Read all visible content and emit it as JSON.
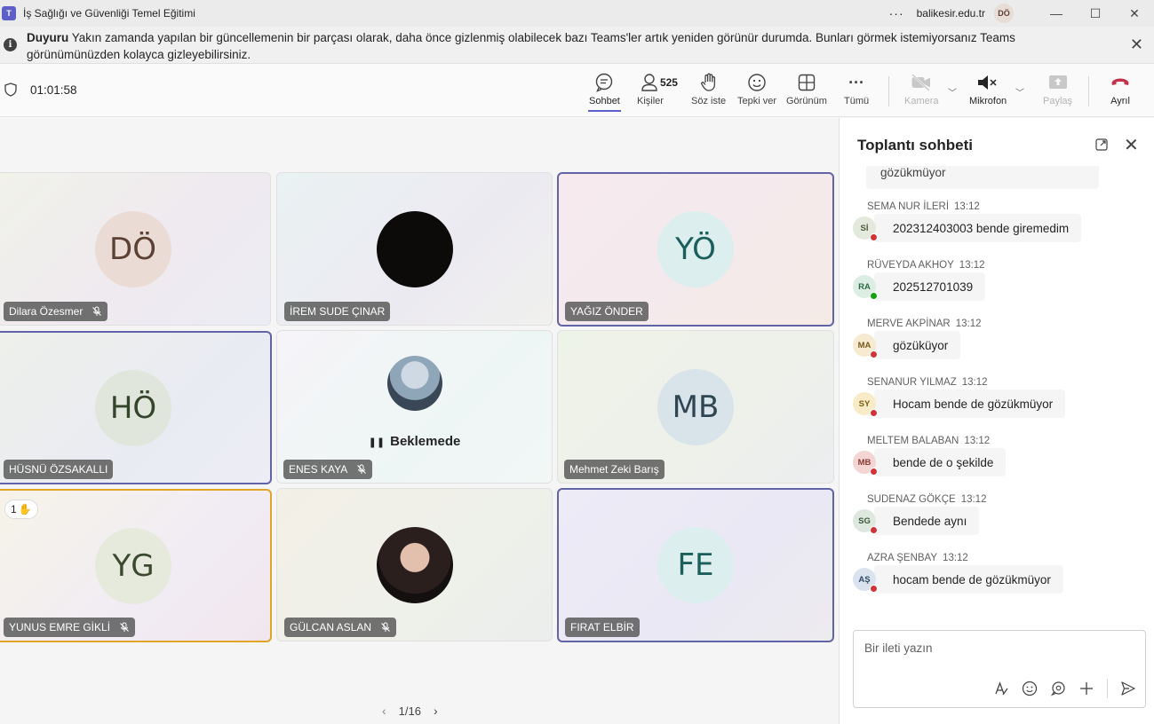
{
  "window": {
    "title": "İş Sağlığı ve Güvenliği Temel Eğitimi",
    "more": "···",
    "org": "balikesir.edu.tr",
    "user_initials": "DÖ",
    "minimize": "—",
    "maximize": "☐",
    "close": "✕"
  },
  "banner": {
    "bold": "Duyuru",
    "text": " Yakın zamanda yapılan bir güncellemenin bir parçası olarak, daha önce gizlenmiş olabilecek bazı Teams'ler artık yeniden görünür durumda. Bunları görmek istemiyorsanız Teams görünümünüzden kolayca gizleyebilirsiniz.",
    "close": "✕"
  },
  "toolbar": {
    "timer": "01:01:58",
    "chat": "Sohbet",
    "people": "Kişiler",
    "people_count": "525",
    "raise": "Söz iste",
    "react": "Tepki ver",
    "view": "Görünüm",
    "more": "Tümü",
    "more_glyph": "···",
    "camera": "Kamera",
    "mic": "Mikrofon",
    "share": "Paylaş",
    "leave": "Ayrıl"
  },
  "tiles": [
    {
      "initials": "DÖ",
      "name": "Dilara Özesmer",
      "muted": true
    },
    {
      "initials": "",
      "name": "İREM SUDE ÇINAR",
      "muted": false
    },
    {
      "initials": "YÖ",
      "name": "YAĞIZ ÖNDER",
      "muted": false
    },
    {
      "initials": "HÖ",
      "name": "HÜSNÜ ÖZSAKALLI",
      "muted": false
    },
    {
      "initials": "",
      "name": "ENES KAYA",
      "muted": true,
      "status": "Beklemede",
      "status_glyph": "❚❚"
    },
    {
      "initials": "MB",
      "name": "Mehmet Zeki Barış",
      "muted": false
    },
    {
      "initials": "YG",
      "name": "YUNUS EMRE GİKLİ",
      "muted": true,
      "hand_count": "1",
      "hand_glyph": "✋"
    },
    {
      "initials": "",
      "name": "GÜLCAN ASLAN",
      "muted": true
    },
    {
      "initials": "FE",
      "name": "FIRAT ELBİR",
      "muted": false
    }
  ],
  "pager": {
    "label": "1/16",
    "prev": "‹",
    "next": "›"
  },
  "chat": {
    "title": "Toplantı sohbeti",
    "close": "✕",
    "first_partial": "gözükmüyor",
    "messages": [
      {
        "author": "SEMA NUR İLERİ",
        "time": "13:12",
        "initials": "Sİ",
        "text": "202312403003 bende giremedim",
        "presence": "busy"
      },
      {
        "author": "RÜVEYDA AKHOY",
        "time": "13:12",
        "initials": "RA",
        "text": "202512701039",
        "presence": "available"
      },
      {
        "author": "MERVE AKPİNAR",
        "time": "13:12",
        "initials": "MA",
        "text": "gözüküyor",
        "presence": "busy"
      },
      {
        "author": "SENANUR YILMAZ",
        "time": "13:12",
        "initials": "SY",
        "text": "Hocam bende de gözükmüyor",
        "presence": "busy"
      },
      {
        "author": "MELTEM BALABAN",
        "time": "13:12",
        "initials": "MB",
        "text": "bende de o şekilde",
        "presence": "busy"
      },
      {
        "author": "SUDENAZ GÖKÇE",
        "time": "13:12",
        "initials": "SG",
        "text": "Bendede aynı",
        "presence": "busy"
      },
      {
        "author": "AZRA ŞENBAY",
        "time": "13:12",
        "initials": "AŞ",
        "text": "hocam bende de gözükmüyor",
        "presence": "busy"
      }
    ],
    "compose_placeholder": "Bir ileti yazın"
  }
}
